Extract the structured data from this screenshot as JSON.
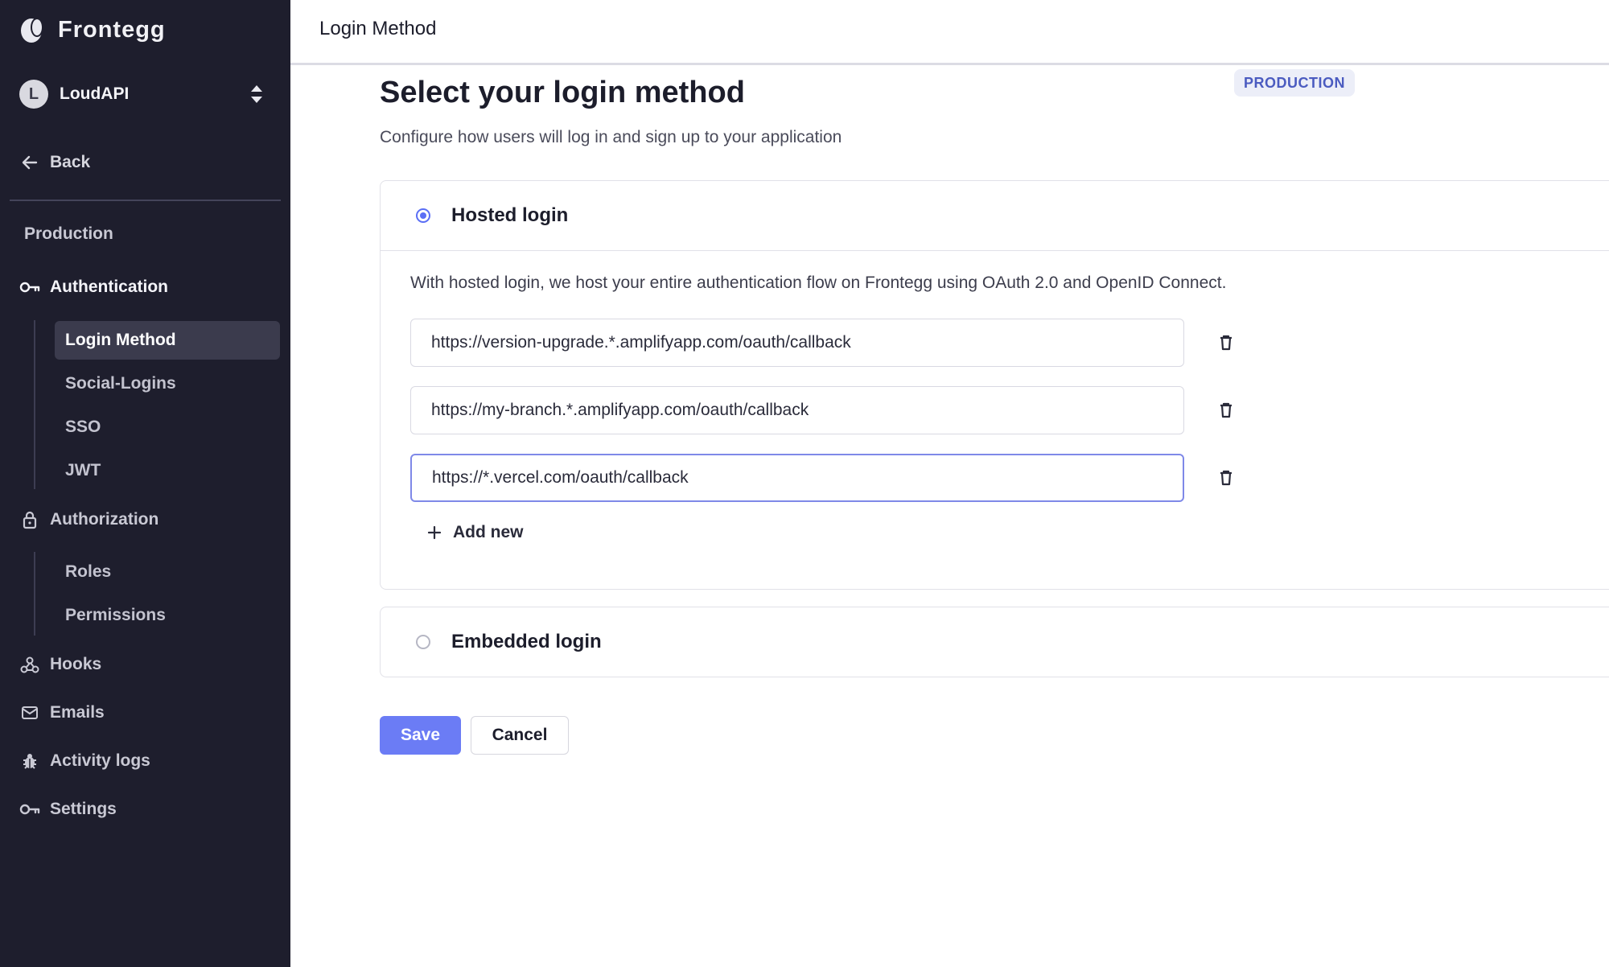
{
  "brand": {
    "name": "Frontegg",
    "icon": "frontegg-logo-icon"
  },
  "workspace": {
    "initial": "L",
    "name": "LoudAPI",
    "switch_icon": "unfold-icon"
  },
  "back": {
    "label": "Back",
    "icon": "arrow-left-icon"
  },
  "environment": {
    "label": "Production"
  },
  "nav": {
    "authentication": {
      "label": "Authentication",
      "icon": "key-icon"
    },
    "auth_items": [
      {
        "label": "Login Method",
        "active": true
      },
      {
        "label": "Social-Logins"
      },
      {
        "label": "SSO"
      },
      {
        "label": "JWT"
      }
    ],
    "authorization": {
      "label": "Authorization",
      "icon": "lock-icon"
    },
    "authz_items": [
      {
        "label": "Roles"
      },
      {
        "label": "Permissions"
      }
    ],
    "hooks": {
      "label": "Hooks",
      "icon": "webhook-icon"
    },
    "emails": {
      "label": "Emails",
      "icon": "mail-icon"
    },
    "activity_logs": {
      "label": "Activity logs",
      "icon": "bug-icon"
    },
    "settings": {
      "label": "Settings",
      "icon": "key-icon"
    }
  },
  "topbar": {
    "title": "Login Method"
  },
  "badge": {
    "label": "PRODUCTION"
  },
  "page": {
    "title": "Select your login method",
    "subtitle": "Configure how users will log in and sign up to your application"
  },
  "hosted": {
    "title": "Hosted login",
    "selected": true,
    "description": "With hosted login, we host your entire authentication flow on Frontegg using OAuth 2.0 and OpenID Connect.",
    "urls": [
      "https://version-upgrade.*.amplifyapp.com/oauth/callback",
      "https://my-branch.*.amplifyapp.com/oauth/callback",
      "https://*.vercel.com/oauth/callback"
    ],
    "add_new_label": "Add new"
  },
  "embedded": {
    "title": "Embedded login",
    "selected": false
  },
  "actions": {
    "save": "Save",
    "cancel": "Cancel"
  },
  "colors": {
    "sidebar": "#1e1e2d",
    "accent": "#6b7cf5",
    "badge_text": "#4b5bc0"
  }
}
